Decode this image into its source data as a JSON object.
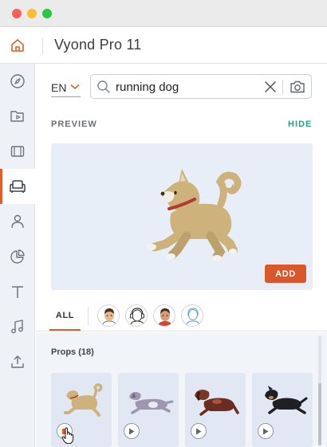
{
  "app": {
    "title": "Vyond Pro 11"
  },
  "titlebar": {
    "buttons": [
      "close",
      "minimize",
      "maximize"
    ]
  },
  "sidebar": {
    "items": [
      {
        "name": "compass-icon"
      },
      {
        "name": "video-folder-icon"
      },
      {
        "name": "film-icon"
      },
      {
        "name": "armchair-icon",
        "active": true
      },
      {
        "name": "person-icon"
      },
      {
        "name": "pie-chart-icon"
      },
      {
        "name": "text-icon"
      },
      {
        "name": "music-icon"
      },
      {
        "name": "upload-icon"
      }
    ]
  },
  "search": {
    "language": "EN",
    "query": "running dog",
    "placeholder": "Search"
  },
  "preview": {
    "label": "PREVIEW",
    "hide_label": "HIDE",
    "add_label": "ADD"
  },
  "tabs": {
    "all_label": "ALL",
    "characters": [
      "character-man-icon",
      "character-headphones-icon",
      "character-man-red-shirt-icon",
      "character-woman-outline-icon"
    ]
  },
  "library": {
    "props_label": "Props (18)",
    "items": [
      {
        "name": "running-dog-tan",
        "state": "playing"
      },
      {
        "name": "running-dog-purple",
        "state": "paused"
      },
      {
        "name": "running-dog-brown",
        "state": "paused"
      },
      {
        "name": "running-dog-black",
        "state": "paused"
      }
    ]
  },
  "colors": {
    "accent": "#e05e2b",
    "teal": "#2a9c8a",
    "preview_bg": "#e8eef7",
    "sidebar_bg": "#eef2f7"
  }
}
